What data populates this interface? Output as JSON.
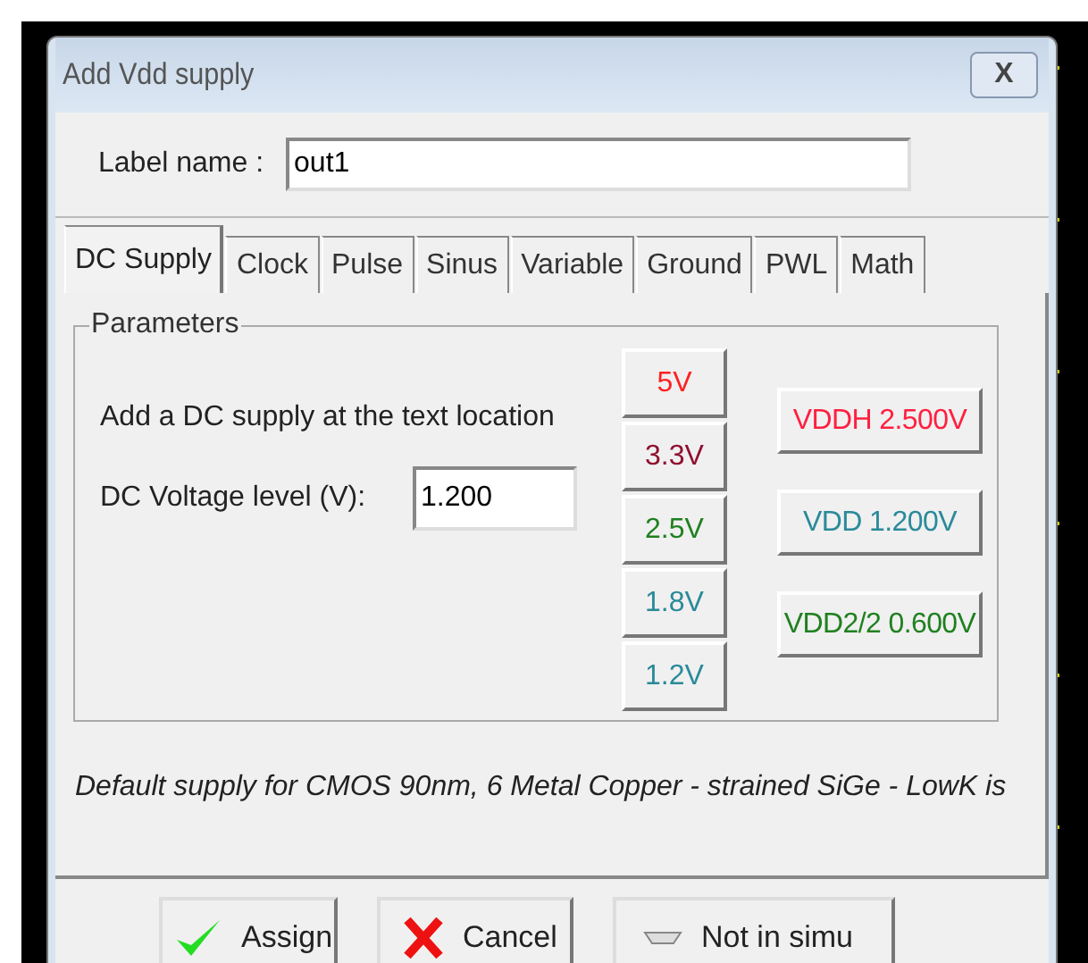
{
  "window": {
    "title": "Add Vdd supply",
    "close": "X"
  },
  "label_name": {
    "label": "Label name :",
    "value": "out1"
  },
  "tabs": [
    {
      "label": "DC Supply",
      "selected": true
    },
    {
      "label": "Clock",
      "selected": false
    },
    {
      "label": "Pulse",
      "selected": false
    },
    {
      "label": "Sinus",
      "selected": false
    },
    {
      "label": "Variable",
      "selected": false
    },
    {
      "label": "Ground",
      "selected": false
    },
    {
      "label": "PWL",
      "selected": false
    },
    {
      "label": "Math",
      "selected": false
    }
  ],
  "parameters": {
    "title": "Parameters",
    "description": "Add a DC supply at the text location",
    "voltage_label": "DC Voltage level (V):",
    "voltage_value": "1.200",
    "quick_buttons": [
      {
        "label": "5V",
        "color": "#ff2020"
      },
      {
        "label": "3.3V",
        "color": "#901030"
      },
      {
        "label": "2.5V",
        "color": "#208020"
      },
      {
        "label": "1.8V",
        "color": "#2a8a9a"
      },
      {
        "label": "1.2V",
        "color": "#2a8a9a"
      }
    ],
    "preset_buttons": [
      {
        "label": "VDDH 2.500V",
        "color": "#ff2040"
      },
      {
        "label": "VDD 1.200V",
        "color": "#2a8a9a"
      },
      {
        "label": "VDD2/2 0.600V",
        "color": "#208020"
      }
    ]
  },
  "note": "Default supply for CMOS 90nm, 6 Metal Copper - strained SiGe - LowK is",
  "buttons": [
    {
      "label": "Assign",
      "kind": "assign"
    },
    {
      "label": "Cancel",
      "kind": "cancel"
    },
    {
      "label": "Not in simu",
      "kind": "off"
    }
  ]
}
